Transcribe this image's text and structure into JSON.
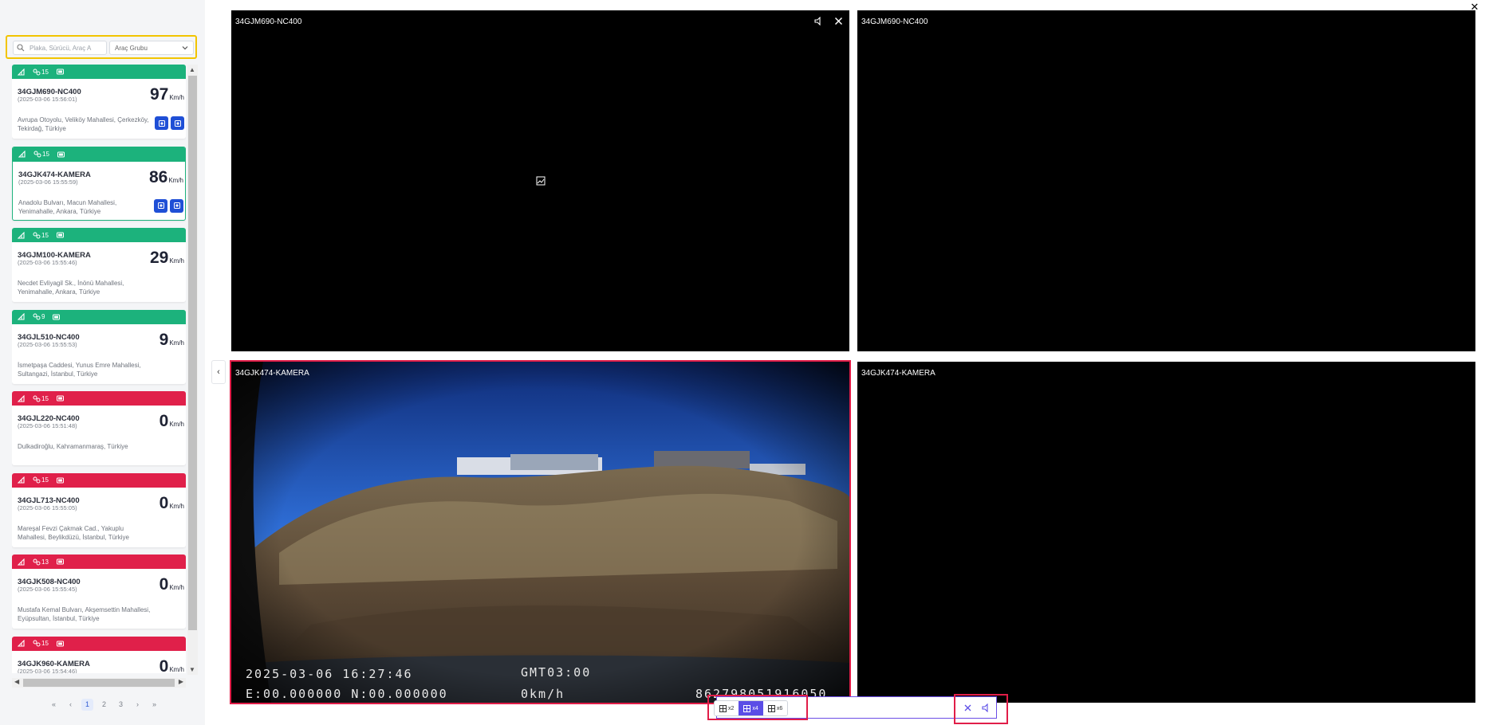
{
  "search": {
    "placeholder": "Plaka, Sürücü, Araç A"
  },
  "group_select": {
    "label": "Araç Grubu"
  },
  "vehicles": [
    {
      "status": "green",
      "sats": "15",
      "plate": "34GJM690-NC400",
      "time": "(2025-03-06 15:56:01)",
      "speed": "97",
      "unit": "Km/h",
      "address": "Avrupa Otoyolu, Veliköy Mahallesi, Çerkezköy, Tekirdağ, Türkiye",
      "buttons": true,
      "selected": false
    },
    {
      "status": "green",
      "sats": "15",
      "plate": "34GJK474-KAMERA",
      "time": "(2025-03-06 15:55:59)",
      "speed": "86",
      "unit": "Km/h",
      "address": "Anadolu Bulvarı, Macun Mahallesi, Yenimahalle, Ankara, Türkiye",
      "buttons": true,
      "selected": true
    },
    {
      "status": "green",
      "sats": "15",
      "plate": "34GJM100-KAMERA",
      "time": "(2025-03-06 15:55:46)",
      "speed": "29",
      "unit": "Km/h",
      "address": "Necdet Evliyagil Sk., İnönü Mahallesi, Yenimahalle, Ankara, Türkiye",
      "buttons": false,
      "selected": false
    },
    {
      "status": "green",
      "sats": "9",
      "plate": "34GJL510-NC400",
      "time": "(2025-03-06 15:55:53)",
      "speed": "9",
      "unit": "Km/h",
      "address": "İsmetpaşa Caddesi, Yunus Emre Mahallesi, Sultangazi, İstanbul, Türkiye",
      "buttons": false,
      "selected": false
    },
    {
      "status": "red",
      "sats": "15",
      "plate": "34GJL220-NC400",
      "time": "(2025-03-06 15:51:48)",
      "speed": "0",
      "unit": "Km/h",
      "address": "Dulkadiroğlu, Kahramanmaraş, Türkiye",
      "buttons": false,
      "selected": false
    },
    {
      "status": "red",
      "sats": "15",
      "plate": "34GJL713-NC400",
      "time": "(2025-03-06 15:55:05)",
      "speed": "0",
      "unit": "Km/h",
      "address": "Mareşal Fevzi Çakmak Cad., Yakuplu Mahallesi, Beylikdüzü, İstanbul, Türkiye",
      "buttons": false,
      "selected": false
    },
    {
      "status": "red",
      "sats": "13",
      "plate": "34GJK508-NC400",
      "time": "(2025-03-06 15:55:45)",
      "speed": "0",
      "unit": "Km/h",
      "address": "Mustafa Kemal Bulvarı, Akşemsettin Mahallesi, Eyüpsultan, İstanbul, Türkiye",
      "buttons": false,
      "selected": false
    },
    {
      "status": "red",
      "sats": "15",
      "plate": "34GJK960-KAMERA",
      "time": "(2025-03-06 15:54:46)",
      "speed": "0",
      "unit": "Km/h",
      "address": "",
      "buttons": false,
      "selected": false
    }
  ],
  "pagination": {
    "first": "«",
    "prev": "‹",
    "pages": [
      "1",
      "2",
      "3"
    ],
    "next": "›",
    "last": "»",
    "current": "1"
  },
  "panels": [
    {
      "title": "34GJM690-NC400"
    },
    {
      "title": "34GJM690-NC400"
    },
    {
      "title": "34GJK474-KAMERA"
    },
    {
      "title": "34GJK474-KAMERA"
    }
  ],
  "osd": {
    "date": "2025-03-06 16:27:46",
    "tz": "GMT03:00",
    "coords": "E:00.000000 N:00.000000",
    "speed": "0km/h",
    "device": "862798051916050"
  },
  "layout": {
    "options": [
      "x2",
      "x4",
      "x6"
    ],
    "active": "x4"
  },
  "colors": {
    "green": "#1cb27c",
    "red": "#e0204a",
    "accent": "#5b4de6",
    "highlight": "#e11d48",
    "filter_border": "#f2c400"
  }
}
